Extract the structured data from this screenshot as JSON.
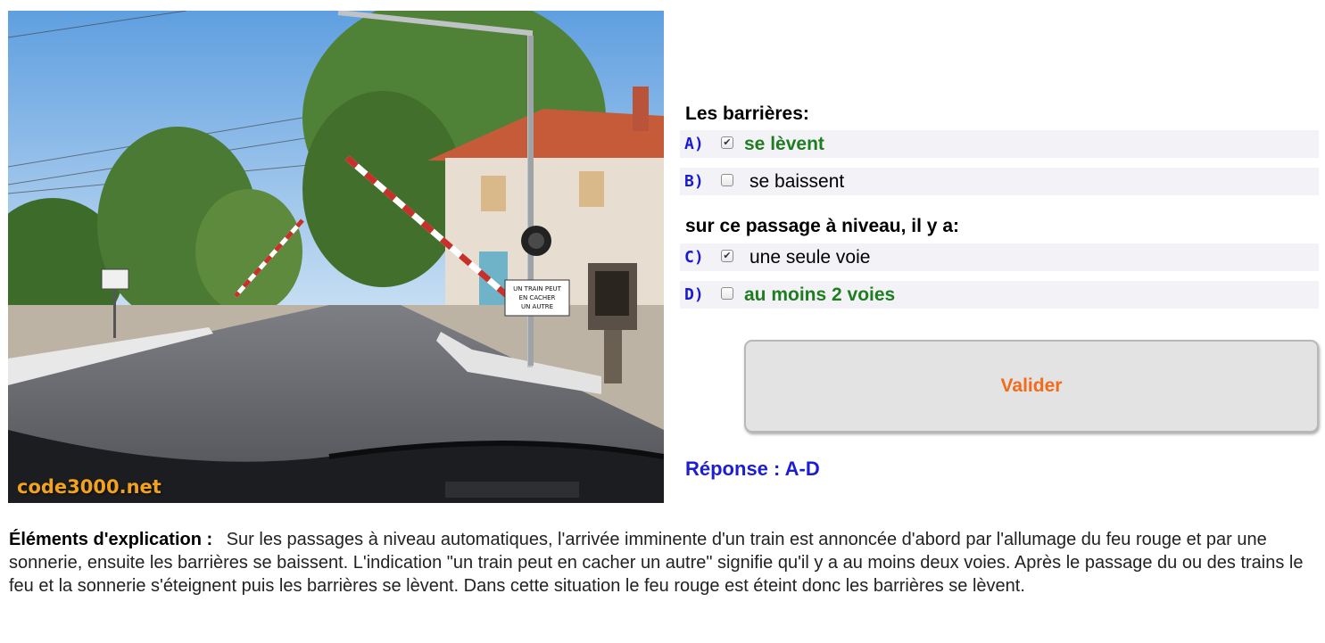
{
  "photo": {
    "watermark": "code3000.net",
    "sign_text": "UN TRAIN PEUT EN CACHER UN AUTRE"
  },
  "question1": {
    "title": "Les barrières:",
    "answers": [
      {
        "letter": "A)",
        "text": "se lèvent",
        "checked": true,
        "correct": true
      },
      {
        "letter": "B)",
        "text": "se baissent",
        "checked": false,
        "correct": false
      }
    ]
  },
  "question2": {
    "title": "sur ce passage à niveau, il y a:",
    "answers": [
      {
        "letter": "C)",
        "text": "une seule voie",
        "checked": true,
        "correct": false
      },
      {
        "letter": "D)",
        "text": "au moins 2 voies",
        "checked": false,
        "correct": true
      }
    ]
  },
  "validate_label": "Valider",
  "result": "Réponse : A-D",
  "explanation": {
    "heading": "Éléments d'explication :",
    "text": "Sur les passages à niveau automatiques, l'arrivée imminente d'un train est annoncée d'abord par l'allumage du feu rouge et par une sonnerie, ensuite les barrières se baissent. L'indication \"un train peut en cacher un autre\" signifie qu'il y a au moins deux voies. Après le passage du ou des trains le feu et la sonnerie s'éteignent puis les barrières se lèvent. Dans cette situation le feu rouge est éteint donc les barrières se lèvent."
  },
  "colors": {
    "correct_answer": "#1e7d1e",
    "letter": "#1919d2",
    "validate_text": "#f26b1a",
    "result": "#1d1dd4"
  }
}
